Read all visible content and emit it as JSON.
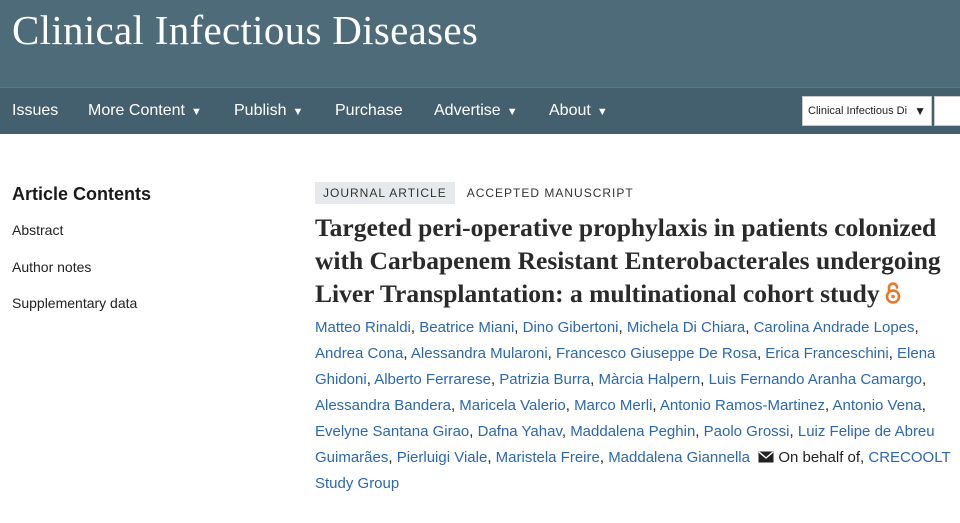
{
  "site": {
    "title": "Clinical Infectious Diseases"
  },
  "nav": {
    "items": [
      {
        "label": "Issues",
        "dropdown": false
      },
      {
        "label": "More Content",
        "dropdown": true
      },
      {
        "label": "Publish",
        "dropdown": true
      },
      {
        "label": "Purchase",
        "dropdown": false
      },
      {
        "label": "Advertise",
        "dropdown": true
      },
      {
        "label": "About",
        "dropdown": true
      }
    ],
    "journal_select": {
      "value": "Clinical Infectious Di",
      "caret": "▼"
    }
  },
  "toc": {
    "heading": "Article Contents",
    "items": [
      "Abstract",
      "Author notes",
      "Supplementary data"
    ]
  },
  "article": {
    "type_badge": "JOURNAL ARTICLE",
    "status": "ACCEPTED MANUSCRIPT",
    "title": "Targeted peri-operative prophylaxis in patients colonized with Carbapenem Resistant Enterobacterales undergoing Liver Transplantation: a multinational cohort study",
    "open_access_icon": "open-access-icon",
    "authors": [
      "Matteo Rinaldi",
      "Beatrice Miani",
      "Dino Gibertoni",
      "Michela Di Chiara",
      "Carolina Andrade Lopes",
      "Andrea Cona",
      "Alessandra Mularoni",
      "Francesco Giuseppe De Rosa",
      "Erica Franceschini",
      "Elena Ghidoni",
      "Alberto Ferrarese",
      "Patrizia Burra",
      "Màrcia Halpern",
      "Luis Fernando Aranha Camargo",
      "Alessandra Bandera",
      "Maricela Valerio",
      "Marco Merli",
      "Antonio Ramos-Martinez",
      "Antonio Vena",
      "Evelyne Santana Girao",
      "Dafna Yahav",
      "Maddalena Peghin",
      "Paolo Grossi",
      "Luiz Felipe de Abreu Guimarães",
      "Pierluigi Viale",
      "Maristela Freire",
      "Maddalena Giannella"
    ],
    "corresponding_icon": "envelope-icon",
    "on_behalf_text": "On behalf of,",
    "study_group": "CRECOOLT Study Group"
  },
  "colors": {
    "masthead": "#4e6b7a",
    "navbar": "#44606f",
    "link": "#2b68b2",
    "open_access": "#e8782a"
  }
}
